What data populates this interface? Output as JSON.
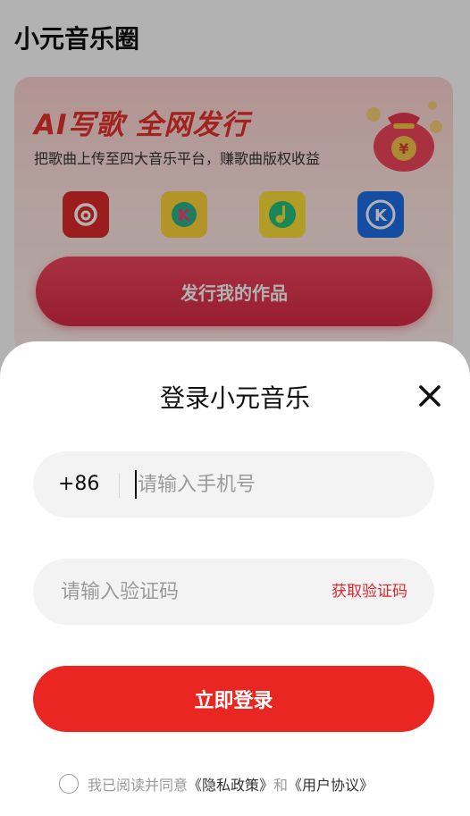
{
  "background": {
    "page_title": "小元音乐圈",
    "promo": {
      "title": "AI写歌  全网发行",
      "subtitle": "把歌曲上传至四大音乐平台，赚歌曲版权收益",
      "button_label": "发行我的作品",
      "platforms": [
        {
          "icon": "netease-music-icon",
          "color": "#e02a2a"
        },
        {
          "icon": "kuwo-music-icon",
          "color": "#ffd43b"
        },
        {
          "icon": "qq-music-icon",
          "color": "#ffe03a"
        },
        {
          "icon": "kugou-music-icon",
          "color": "#1e6fe8"
        }
      ]
    }
  },
  "login": {
    "title": "登录小元音乐",
    "country_code": "+86",
    "phone_placeholder": "请输入手机号",
    "code_placeholder": "请输入验证码",
    "get_code_label": "获取验证码",
    "login_button_label": "立即登录",
    "agreement": {
      "prefix": "我已阅读并同意",
      "privacy_link": "《隐私政策》",
      "connector": "和",
      "terms_link": "《用户协议》"
    },
    "accent_color": "#ea2622"
  }
}
